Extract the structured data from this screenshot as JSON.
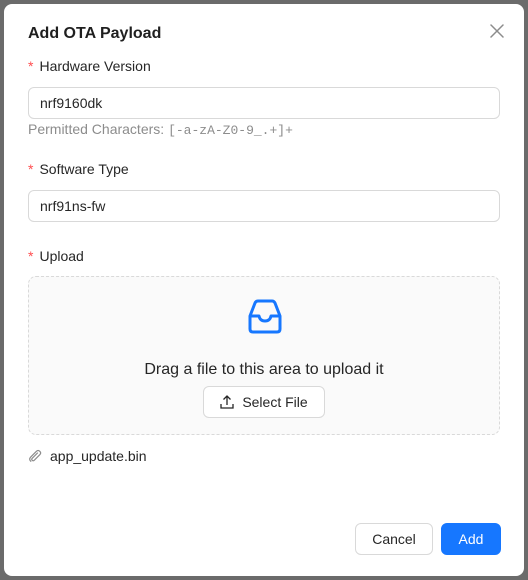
{
  "dialog": {
    "title": "Add OTA Payload"
  },
  "form": {
    "hardware_version": {
      "label": "Hardware Version",
      "value": "nrf9160dk",
      "help_prefix": "Permitted Characters:",
      "help_pattern": "[-a-zA-Z0-9_.+]+"
    },
    "software_type": {
      "label": "Software Type",
      "value": "nrf91ns-fw"
    },
    "upload": {
      "label": "Upload",
      "drop_text": "Drag a file to this area to upload it",
      "select_label": "Select File",
      "file_name": "app_update.bin"
    },
    "required_mark": "*"
  },
  "footer": {
    "cancel_label": "Cancel",
    "add_label": "Add"
  },
  "icons": {
    "close": "close-icon",
    "inbox": "inbox-icon",
    "upload": "upload-icon",
    "attachment": "paperclip-icon"
  },
  "colors": {
    "primary": "#1677ff",
    "required": "#ff4d4f",
    "border": "#d9d9d9",
    "muted_text": "#8c8c8c"
  }
}
